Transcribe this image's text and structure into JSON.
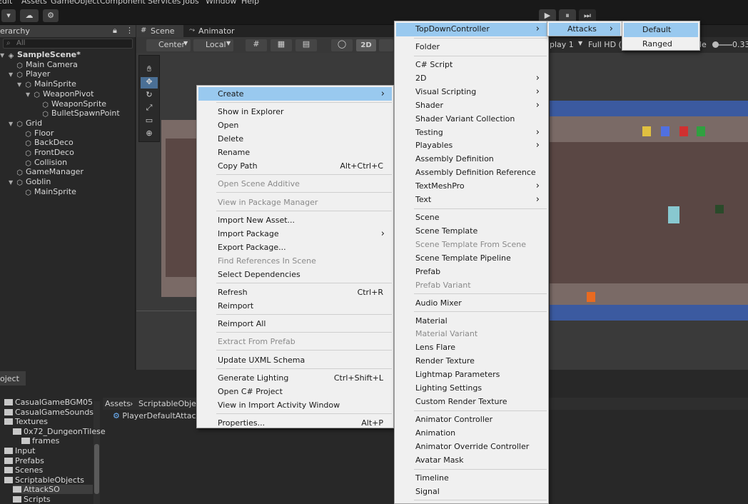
{
  "menubar": [
    "Edit",
    "Assets",
    "GameObject",
    "Component",
    "Services",
    "Jobs",
    "Window",
    "Help"
  ],
  "toolbar": {
    "play": "▶",
    "pause": "⏸",
    "step": "⏭"
  },
  "hierarchy": {
    "title": "erarchy",
    "search_placeholder": "All",
    "items": [
      {
        "label": "SampleScene*",
        "depth": 0,
        "icon": "unity-scene-icon"
      },
      {
        "label": "Main Camera",
        "depth": 1,
        "icon": "cube-icon"
      },
      {
        "label": "Player",
        "depth": 1,
        "icon": "cube-icon"
      },
      {
        "label": "MainSprite",
        "depth": 2,
        "icon": "cube-icon"
      },
      {
        "label": "WeaponPivot",
        "depth": 3,
        "icon": "cube-icon"
      },
      {
        "label": "WeaponSprite",
        "depth": 4,
        "icon": "cube-icon"
      },
      {
        "label": "BulletSpawnPoint",
        "depth": 4,
        "icon": "cube-icon"
      },
      {
        "label": "Grid",
        "depth": 1,
        "icon": "cube-icon"
      },
      {
        "label": "Floor",
        "depth": 2,
        "icon": "cube-icon"
      },
      {
        "label": "BackDeco",
        "depth": 2,
        "icon": "cube-icon"
      },
      {
        "label": "FrontDeco",
        "depth": 2,
        "icon": "cube-icon"
      },
      {
        "label": "Collision",
        "depth": 2,
        "icon": "cube-icon"
      },
      {
        "label": "GameManager",
        "depth": 1,
        "icon": "cube-icon"
      },
      {
        "label": "Goblin",
        "depth": 1,
        "icon": "cube-icon"
      },
      {
        "label": "MainSprite",
        "depth": 2,
        "icon": "cube-icon"
      }
    ]
  },
  "scene": {
    "tabs": [
      "Scene",
      "Animator"
    ],
    "toolbar": {
      "pivot": "Center",
      "space": "Local",
      "mode_2d": "2D"
    },
    "game_view": {
      "display": "play 1",
      "resolution": "Full HD (1",
      "scale_label": "le",
      "scale_value": "0.33"
    }
  },
  "project": {
    "tab": "oject",
    "folders": [
      "CasualGameBGM05",
      "CasualGameSounds",
      "Textures",
      "0x72_DungeonTilese",
      "frames",
      "Input",
      "Prefabs",
      "Scenes",
      "ScriptableObjects",
      "AttackSO",
      "Scripts"
    ],
    "breadcrumb": [
      "Assets",
      "ScriptableObject"
    ],
    "asset": "PlayerDefaultAttackS"
  },
  "context_menu": {
    "items": [
      {
        "label": "Create",
        "highlight": true,
        "submenu": true
      },
      {
        "sep": true
      },
      {
        "label": "Show in Explorer"
      },
      {
        "label": "Open"
      },
      {
        "label": "Delete"
      },
      {
        "label": "Rename"
      },
      {
        "label": "Copy Path",
        "shortcut": "Alt+Ctrl+C"
      },
      {
        "sep": true
      },
      {
        "label": "Open Scene Additive",
        "disabled": true
      },
      {
        "sep": true
      },
      {
        "label": "View in Package Manager",
        "disabled": true
      },
      {
        "sep": true
      },
      {
        "label": "Import New Asset..."
      },
      {
        "label": "Import Package",
        "submenu": true
      },
      {
        "label": "Export Package..."
      },
      {
        "label": "Find References In Scene",
        "disabled": true
      },
      {
        "label": "Select Dependencies"
      },
      {
        "sep": true
      },
      {
        "label": "Refresh",
        "shortcut": "Ctrl+R"
      },
      {
        "label": "Reimport"
      },
      {
        "sep": true
      },
      {
        "label": "Reimport All"
      },
      {
        "sep": true
      },
      {
        "label": "Extract From Prefab",
        "disabled": true
      },
      {
        "sep": true
      },
      {
        "label": "Update UXML Schema"
      },
      {
        "sep": true
      },
      {
        "label": "Generate Lighting",
        "shortcut": "Ctrl+Shift+L"
      },
      {
        "label": "Open C# Project"
      },
      {
        "label": "View in Import Activity Window"
      },
      {
        "sep": true
      },
      {
        "label": "Properties...",
        "shortcut": "Alt+P"
      }
    ]
  },
  "create_menu": {
    "items": [
      {
        "label": "TopDownController",
        "highlight": true,
        "submenu": true
      },
      {
        "sep": true
      },
      {
        "label": "Folder"
      },
      {
        "sep": true
      },
      {
        "label": "C# Script"
      },
      {
        "label": "2D",
        "submenu": true
      },
      {
        "label": "Visual Scripting",
        "submenu": true
      },
      {
        "label": "Shader",
        "submenu": true
      },
      {
        "label": "Shader Variant Collection"
      },
      {
        "label": "Testing",
        "submenu": true
      },
      {
        "label": "Playables",
        "submenu": true
      },
      {
        "label": "Assembly Definition"
      },
      {
        "label": "Assembly Definition Reference"
      },
      {
        "label": "TextMeshPro",
        "submenu": true
      },
      {
        "label": "Text",
        "submenu": true
      },
      {
        "sep": true
      },
      {
        "label": "Scene"
      },
      {
        "label": "Scene Template"
      },
      {
        "label": "Scene Template From Scene",
        "disabled": true
      },
      {
        "label": "Scene Template Pipeline"
      },
      {
        "label": "Prefab"
      },
      {
        "label": "Prefab Variant",
        "disabled": true
      },
      {
        "sep": true
      },
      {
        "label": "Audio Mixer"
      },
      {
        "sep": true
      },
      {
        "label": "Material"
      },
      {
        "label": "Material Variant",
        "disabled": true
      },
      {
        "label": "Lens Flare"
      },
      {
        "label": "Render Texture"
      },
      {
        "label": "Lightmap Parameters"
      },
      {
        "label": "Lighting Settings"
      },
      {
        "label": "Custom Render Texture"
      },
      {
        "sep": true
      },
      {
        "label": "Animator Controller"
      },
      {
        "label": "Animation"
      },
      {
        "label": "Animator Override Controller"
      },
      {
        "label": "Avatar Mask"
      },
      {
        "sep": true
      },
      {
        "label": "Timeline"
      },
      {
        "label": "Signal"
      },
      {
        "sep": true
      }
    ]
  },
  "topdown_menu": {
    "items": [
      {
        "label": "Attacks",
        "highlight": true,
        "submenu": true
      }
    ]
  },
  "attacks_menu": {
    "items": [
      {
        "label": "Default",
        "highlight": true
      },
      {
        "label": "Ranged"
      }
    ]
  }
}
